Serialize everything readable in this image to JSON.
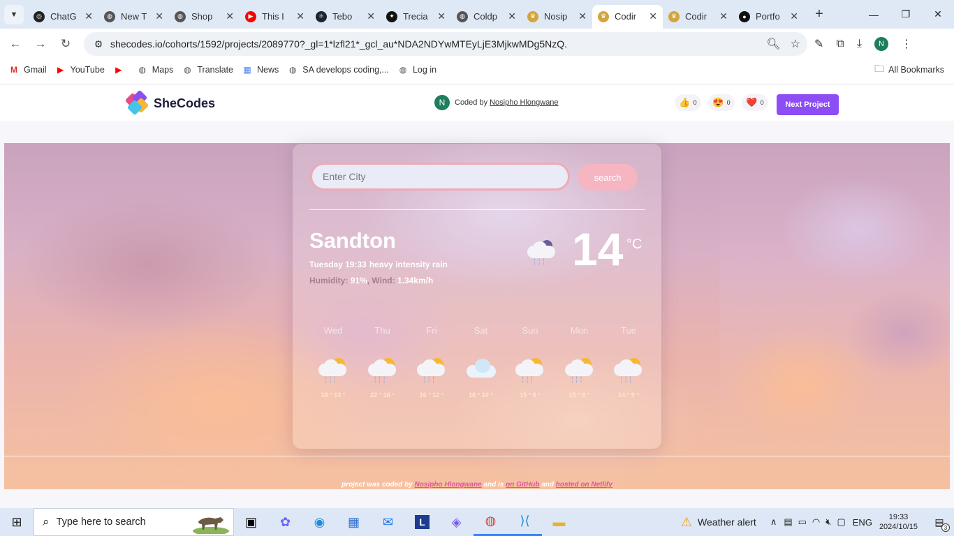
{
  "browser": {
    "tabs": [
      {
        "title": "ChatG",
        "icon": "openai-icon",
        "color": "#222222"
      },
      {
        "title": "New T",
        "icon": "chrome-icon",
        "color": "#555555"
      },
      {
        "title": "Shop",
        "icon": "globe-icon",
        "color": "#555555"
      },
      {
        "title": "This I",
        "icon": "youtube-icon",
        "color": "#ff0000"
      },
      {
        "title": "Tebo",
        "icon": "react-icon",
        "color": "#1b2430"
      },
      {
        "title": "Trecia",
        "icon": "figma-icon",
        "color": "#111111"
      },
      {
        "title": "Coldp",
        "icon": "globe-icon",
        "color": "#555555"
      },
      {
        "title": "Nosip",
        "icon": "shecodes-icon",
        "color": "#d4a53c"
      },
      {
        "title": "Codir",
        "icon": "shecodes-icon",
        "color": "#d4a53c",
        "active": true
      },
      {
        "title": "Codir",
        "icon": "shecodes-icon",
        "color": "#d4a53c"
      },
      {
        "title": "Portfo",
        "icon": "github-icon",
        "color": "#111111"
      }
    ],
    "url": "shecodes.io/cohorts/1592/projects/2089770?_gl=1*lzfl21*_gcl_au*NDA2NDYwMTEyLjE3MjkwMDg5NzQ.",
    "profile_initial": "N",
    "bookmarks": [
      {
        "label": "Gmail",
        "icon": "gmail-icon"
      },
      {
        "label": "YouTube",
        "icon": "youtube-icon"
      },
      {
        "label": "",
        "icon": "youtube-icon"
      },
      {
        "label": "Maps",
        "icon": "globe-icon"
      },
      {
        "label": "Translate",
        "icon": "globe-icon"
      },
      {
        "label": "News",
        "icon": "news-icon"
      },
      {
        "label": "SA develops coding,...",
        "icon": "globe-icon"
      },
      {
        "label": "Log in",
        "icon": "globe-icon"
      }
    ],
    "all_bookmarks": "All Bookmarks"
  },
  "shecodes": {
    "logo_text": "SheCodes",
    "avatar_initial": "N",
    "coded_by_prefix": "Coded by",
    "author": "Nosipho Hlongwane",
    "reactions": [
      {
        "emoji": "👍",
        "count": "0"
      },
      {
        "emoji": "😍",
        "count": "0"
      },
      {
        "emoji": "❤️",
        "count": "0"
      }
    ],
    "next_project": "Next Project"
  },
  "weather": {
    "input_placeholder": "Enter City",
    "search_label": "search",
    "city": "Sandton",
    "day_time": "Tuesday 19:33",
    "description": "heavy intensity rain",
    "humidity_label": "Humidity:",
    "humidity_value": "91%",
    "wind_label": ", Wind:",
    "wind_value": "1.34km/h",
    "temperature": "14",
    "unit": "°C",
    "current_icon": "night-rain-cloud-icon",
    "forecast": [
      {
        "day": "Wed",
        "temps": "18 ° 13 °",
        "icon": "sun-rain-cloud-icon"
      },
      {
        "day": "Thu",
        "temps": "22 ° 16 °",
        "icon": "sun-rain-cloud-icon"
      },
      {
        "day": "Fri",
        "temps": "16 ° 12 °",
        "icon": "sun-rain-cloud-icon"
      },
      {
        "day": "Sat",
        "temps": "16 ° 10 °",
        "icon": "cloud-icon"
      },
      {
        "day": "Sun",
        "temps": "15 ° 8 °",
        "icon": "sun-rain-cloud-icon"
      },
      {
        "day": "Mon",
        "temps": "15 ° 8 °",
        "icon": "sun-rain-cloud-icon"
      },
      {
        "day": "Tue",
        "temps": "14 ° 9 °",
        "icon": "sun-rain-cloud-icon"
      }
    ],
    "footer": {
      "prefix": "project was coded by",
      "author": "Nosipho Hlongwane",
      "mid": "and is",
      "github": "on GitHub",
      "and": "and",
      "netlify": "hosted on Netlify"
    }
  },
  "taskbar": {
    "search_placeholder": "Type here to search",
    "weather_alert": "Weather alert",
    "language": "ENG",
    "time": "19:33",
    "date": "2024/10/15",
    "notification_count": "3"
  }
}
